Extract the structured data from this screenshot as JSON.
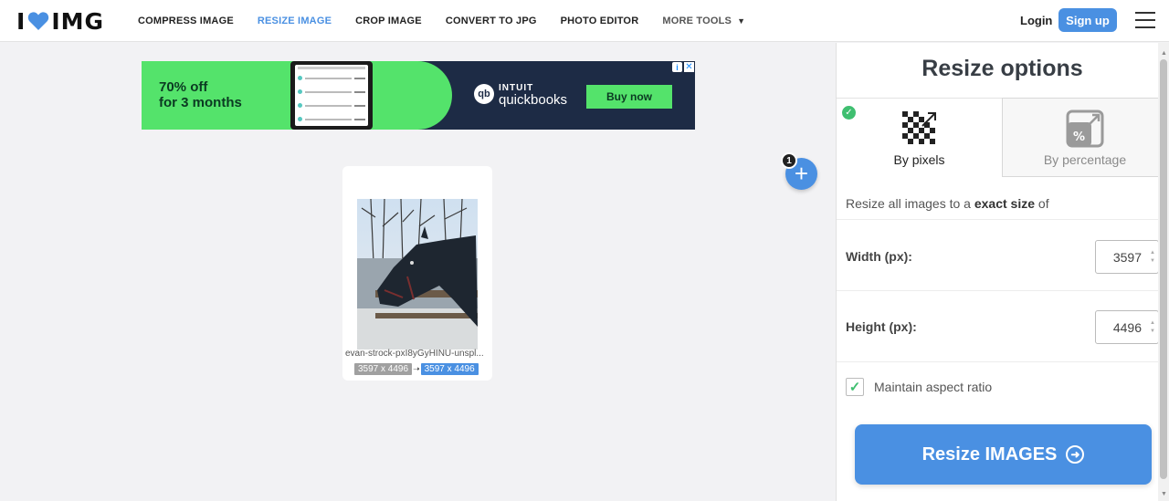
{
  "header": {
    "logo_left": "I",
    "logo_right": "IMG",
    "nav": [
      {
        "label": "COMPRESS IMAGE"
      },
      {
        "label": "RESIZE IMAGE"
      },
      {
        "label": "CROP IMAGE"
      },
      {
        "label": "CONVERT TO JPG"
      },
      {
        "label": "PHOTO EDITOR"
      },
      {
        "label": "MORE TOOLS"
      }
    ],
    "login": "Login",
    "signup": "Sign up",
    "accent_color": "#4a90e2"
  },
  "ad": {
    "headline_1": "70% off",
    "headline_2": "for 3 months",
    "brand_top": "INTUIT",
    "brand_bottom": "quickbooks",
    "cta": "Buy now"
  },
  "file": {
    "name": "evan-strock-pxI8yGyHINU-unspl...",
    "original_size": "3597 x 4496",
    "new_size": "3597 x 4496"
  },
  "add_button": {
    "count": "1"
  },
  "sidebar": {
    "title": "Resize options",
    "tabs": [
      {
        "label": "By pixels",
        "selected": true
      },
      {
        "label": "By percentage",
        "selected": false
      }
    ],
    "description_prefix": "Resize all images to a ",
    "description_bold": "exact size",
    "description_suffix": " of",
    "width_label": "Width (px):",
    "width_value": "3597",
    "height_label": "Height (px):",
    "height_value": "4496",
    "aspect_label": "Maintain aspect ratio",
    "aspect_checked": true,
    "submit_label": "Resize IMAGES"
  }
}
